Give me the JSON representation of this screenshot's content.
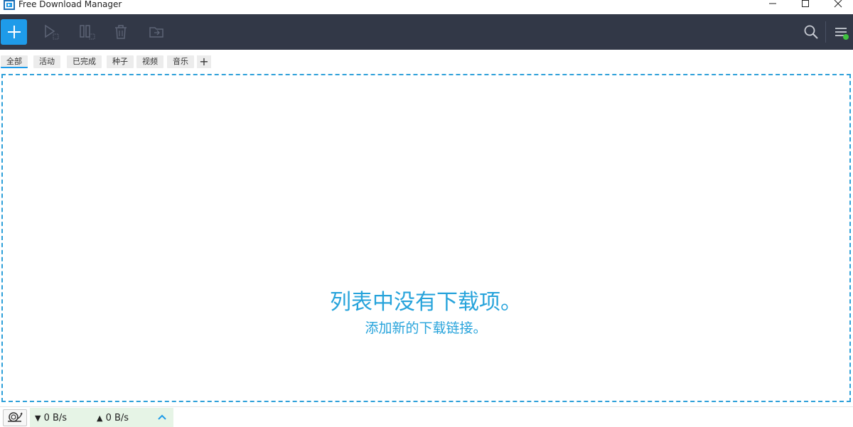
{
  "window": {
    "title": "Free Download Manager"
  },
  "toolbar": {
    "add_icon": "plus-icon",
    "resume_icon": "play-icon",
    "pause_icon": "pause-icon",
    "delete_icon": "trash-icon",
    "folder_icon": "folder-move-icon",
    "search_icon": "search-icon",
    "menu_icon": "hamburger-menu-icon",
    "accent": "#1e9be9",
    "background": "#323847",
    "status_dot_color": "#3fc33f"
  },
  "tabs": [
    {
      "label": "全部",
      "active": true
    },
    {
      "label": "活动"
    },
    {
      "label": "已完成"
    },
    {
      "label": "种子"
    },
    {
      "label": "视频"
    },
    {
      "label": "音乐"
    }
  ],
  "tabs_add_label": "+",
  "empty_state": {
    "message": "列表中没有下载项。",
    "hint": "添加新的下载链接。",
    "color": "#26a3db"
  },
  "statusbar": {
    "download_speed": "0 B/s",
    "upload_speed": "0 B/s",
    "download_arrow": "▼",
    "upload_arrow": "▲",
    "snail_icon": "snail-icon",
    "expand_icon": "chevron-up-icon"
  }
}
